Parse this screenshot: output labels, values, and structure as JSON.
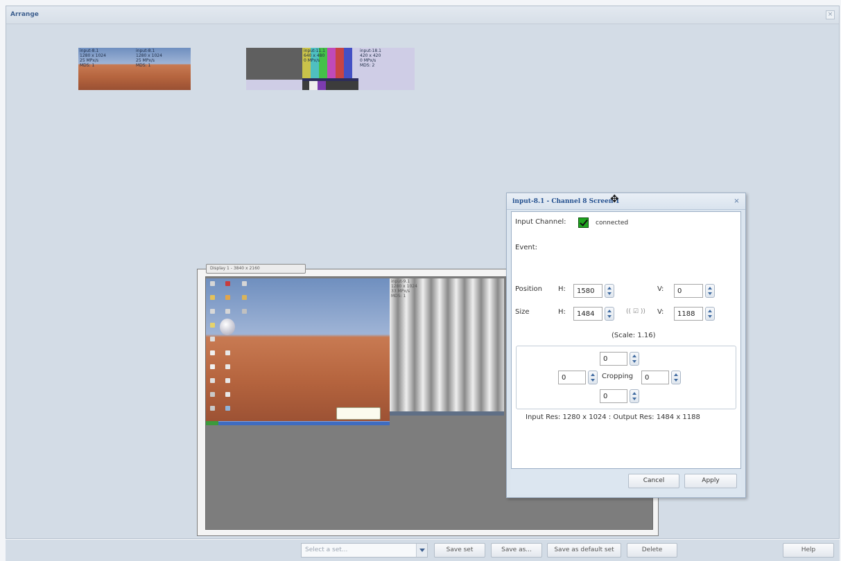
{
  "window": {
    "title": "Arrange",
    "close": "×"
  },
  "thumbnails": {
    "a": {
      "text": "input-8.1\n1280 x 1024\n25 MPx/s\nMDS: 1"
    },
    "b": {
      "text": "input-8.1\n1280 x 1024\n25 MPx/s\nMDS: 1"
    },
    "c": {
      "text": "input-11.1\n640 x 480\n0 MPx/s"
    },
    "d": {
      "text": "input-18.1\n420 x 420\n0 MPx/s\nMDS: 2"
    }
  },
  "display": {
    "label": "Display 1 - 3840 x 2160",
    "overlay_text": "input-9.1\n1280 x 1024\n33 MPx/s\nMDS: 1"
  },
  "dialog": {
    "title": "input-8.1 - Channel 8 Screen 1",
    "close": "×",
    "input_channel_label": "Input Channel:",
    "input_channel_status": "connected",
    "event_label": "Event:",
    "position_label": "Position",
    "size_label": "Size",
    "h_label": "H:",
    "v_label": "V:",
    "position_h": "1580",
    "position_v": "0",
    "size_h": "1484",
    "size_v": "1188",
    "aspect_lock": "(( ☑ ))",
    "scale_text": "(Scale: 1.16)",
    "cropping_label": "Cropping",
    "crop_top": "0",
    "crop_left": "0",
    "crop_right": "0",
    "crop_bottom": "0",
    "res_text": "Input Res: 1280 x 1024 : Output Res: 1484 x 1188",
    "cancel": "Cancel",
    "apply": "Apply"
  },
  "bottom": {
    "select_placeholder": "Select a set...",
    "save_set": "Save set",
    "save_as": "Save as...",
    "save_default": "Save as default set",
    "delete": "Delete",
    "help": "Help"
  },
  "colors": {
    "window_bg": "#d3dce6",
    "dialog_title": "#24508f",
    "connected_green": "#1fa51f"
  },
  "icons": [
    "close-icon",
    "move-cursor-icon",
    "checkbox-checked-icon",
    "spinner-arrows-icon",
    "dropdown-arrow-icon"
  ]
}
